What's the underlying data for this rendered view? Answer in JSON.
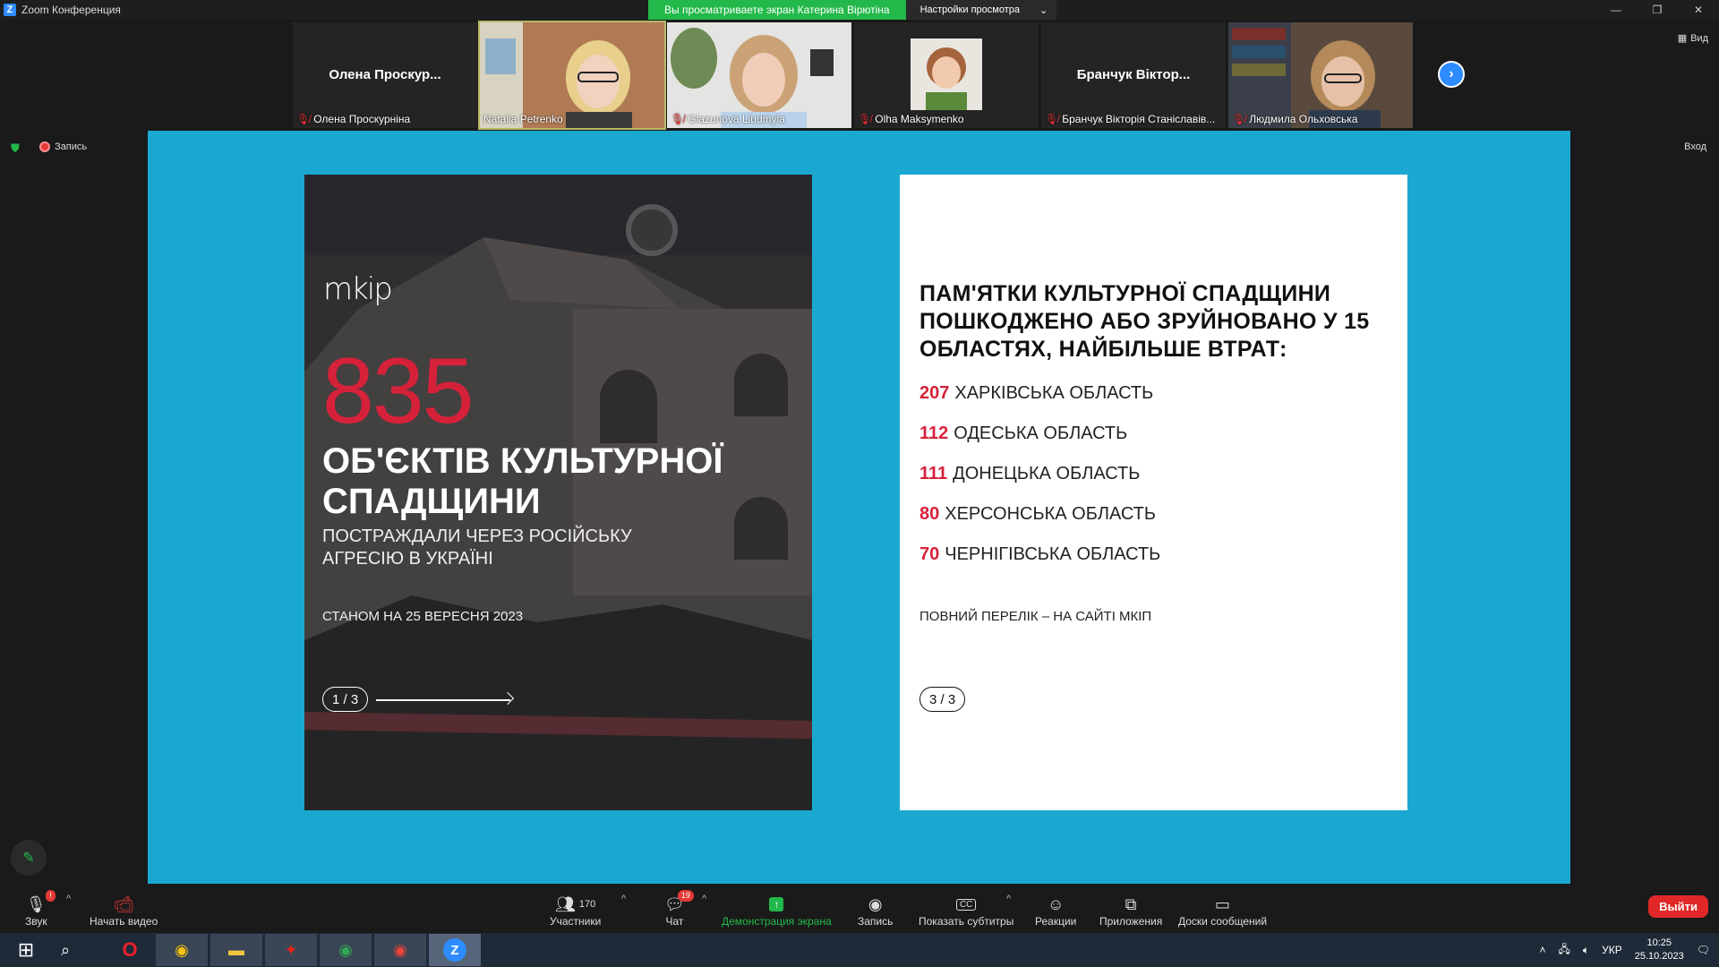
{
  "window": {
    "title": "Zoom Конференция",
    "banner_text": "Вы просматриваете экран Катерина Вірютіна",
    "view_settings": "Настройки просмотра",
    "view_label": "Вид",
    "enter_label": "Вход"
  },
  "gallery": [
    {
      "big_name": "Олена  Проскур...",
      "label": "Олена Проскурніна",
      "muted": true,
      "video": false
    },
    {
      "big_name": "",
      "label": "Natalia Petrenko",
      "muted": false,
      "video": true,
      "active": true
    },
    {
      "big_name": "",
      "label": "Glazunova Liudmyla",
      "muted": true,
      "video": true
    },
    {
      "big_name": "",
      "label": "Olha Maksymenko",
      "muted": true,
      "video": true
    },
    {
      "big_name": "Бранчук Віктор...",
      "label": "Бранчук Вікторія Станіславів...",
      "muted": true,
      "video": false
    },
    {
      "big_name": "",
      "label": "Людмила Ольховська",
      "muted": true,
      "video": true
    }
  ],
  "status": {
    "recording_label": "Запись"
  },
  "slide": {
    "poster": {
      "logo": "mkip",
      "big_number": "835",
      "heading": "ОБ'ЄКТІВ КУЛЬТУРНОЇ СПАДЩИНИ",
      "subheading": "ПОСТРАЖДАЛИ ЧЕРЕЗ РОСІЙСЬКУ АГРЕСІЮ В УКРАЇНІ",
      "date": "СТАНОМ НА 25 ВЕРЕСНЯ 2023",
      "page": "1 / 3"
    },
    "card": {
      "title": "ПАМ'ЯТКИ КУЛЬТУРНОЇ СПАДЩИНИ ПОШКОДЖЕНО АБО ЗРУЙНОВАНО У 15 ОБЛАСТЯХ, НАЙБІЛЬШЕ ВТРАТ:",
      "rows": [
        {
          "num": "207",
          "region": "ХАРКІВСЬКА ОБЛАСТЬ"
        },
        {
          "num": "112",
          "region": "ОДЕСЬКА ОБЛАСТЬ"
        },
        {
          "num": "111",
          "region": "ДОНЕЦЬКА ОБЛАСТЬ"
        },
        {
          "num": "80",
          "region": "ХЕРСОНСЬКА ОБЛАСТЬ"
        },
        {
          "num": "70",
          "region": "ЧЕРНІГІВСЬКА ОБЛАСТЬ"
        }
      ],
      "note": "ПОВНИЙ ПЕРЕЛІК – НА САЙТІ МКІП",
      "page": "3 / 3"
    }
  },
  "toolbar": {
    "audio": "Звук",
    "video": "Начать видео",
    "participants": "Участники",
    "participants_count": "170",
    "chat": "Чат",
    "chat_badge": "19",
    "share": "Демонстрация экрана",
    "record": "Запись",
    "captions": "Показать субтитры",
    "captions_icon_text": "CC",
    "reactions": "Реакции",
    "apps": "Приложения",
    "whiteboards": "Доски сообщений",
    "leave": "Выйти"
  },
  "taskbar": {
    "lang": "УКР",
    "time": "10:25",
    "date": "25.10.2023"
  }
}
